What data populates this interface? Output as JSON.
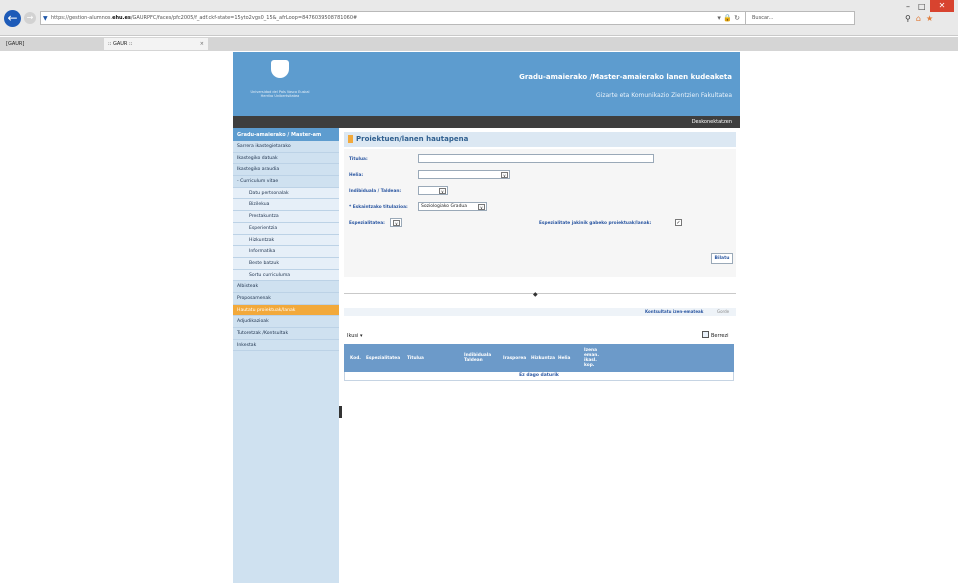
{
  "browser": {
    "url_prefix": "https://gestion-alumnos.",
    "url_domain": "ehu.es",
    "url_path": "/GAURPFC/faces/pfc2005/f_adf.ckf-state=15yto2vgs0_15&_afrLoop=8476039508781060#",
    "search_placeholder": "Buscar...",
    "tabs": [
      {
        "label": "[GAUR]"
      },
      {
        "label": ":: GAUR ::"
      }
    ]
  },
  "header": {
    "logo_text": "Universidad del País Vasco   Euskal Herriko Unibertsitatea",
    "app_title": "Gradu-amaierako /Master-amaierako lanen kudeaketa",
    "faculty": "Gizarte eta Komunikazio Zientzien Fakultatea",
    "logout": "Deskonektatzen"
  },
  "sidebar": {
    "heading": "Gradu-amaierako / Master-am",
    "items": [
      {
        "label": "Sarrera ikastegietarako",
        "type": "item"
      },
      {
        "label": "Ikastegiko datuak",
        "type": "item"
      },
      {
        "label": "Ikastegiko araudia",
        "type": "item"
      },
      {
        "label": "- Curriculum vitae",
        "type": "group"
      },
      {
        "label": "Datu pertsonalak",
        "type": "sub"
      },
      {
        "label": "Bizilekua",
        "type": "sub"
      },
      {
        "label": "Prestakuntza",
        "type": "sub"
      },
      {
        "label": "Esperientzia",
        "type": "sub"
      },
      {
        "label": "Hizkuntzak",
        "type": "sub"
      },
      {
        "label": "Informatika",
        "type": "sub"
      },
      {
        "label": "Beste batzuk",
        "type": "sub"
      },
      {
        "label": "Sortu curriculuma",
        "type": "sub"
      },
      {
        "label": "Albisteak",
        "type": "item"
      },
      {
        "label": "Proposamenak",
        "type": "item"
      },
      {
        "label": "Hautatu proiektuak/lanak",
        "type": "active"
      },
      {
        "label": "Adjudikazioak",
        "type": "item"
      },
      {
        "label": "Tutoretzak /Kontsultak",
        "type": "item"
      },
      {
        "label": "Inkestak",
        "type": "item"
      }
    ]
  },
  "main": {
    "title": "Proiektuen/lanen hautapena",
    "form": {
      "title_label": "Titulua:",
      "title_value": "",
      "goal_label": "Helia:",
      "goal_value": "",
      "individual_label": "Indibiduala / Taldean:",
      "individual_value": "",
      "degree_label": "* Eskaintzako titulazioa:",
      "degree_value": "Soziologiako Gradua",
      "specialty_label": "Espezialitatea:",
      "specialty_value": "",
      "specialty_check_label": "Espezialitate jakinik gabeko proiektuak/lanak:",
      "search_button": "Bilatu"
    },
    "controls": {
      "control_columns": "Kontsultatu izen-emateak",
      "other": "Gorde"
    },
    "toolbar": {
      "export": "Ikusi",
      "clear": "Berrezi"
    },
    "table": {
      "columns": [
        "Kod.",
        "Espezialitatea",
        "Titulua",
        "Indibiduala Taldean",
        "Irasporea",
        "Hizkuntza",
        "Helia",
        "Izena eman. ikasl. kop."
      ],
      "empty_message": "Ez dago daturik"
    }
  },
  "colors": {
    "header_blue": "#5d9ccf",
    "sidebar_bg": "#cfe1f0",
    "active_item": "#f2a93b",
    "grid_header": "#6c9ac9"
  }
}
